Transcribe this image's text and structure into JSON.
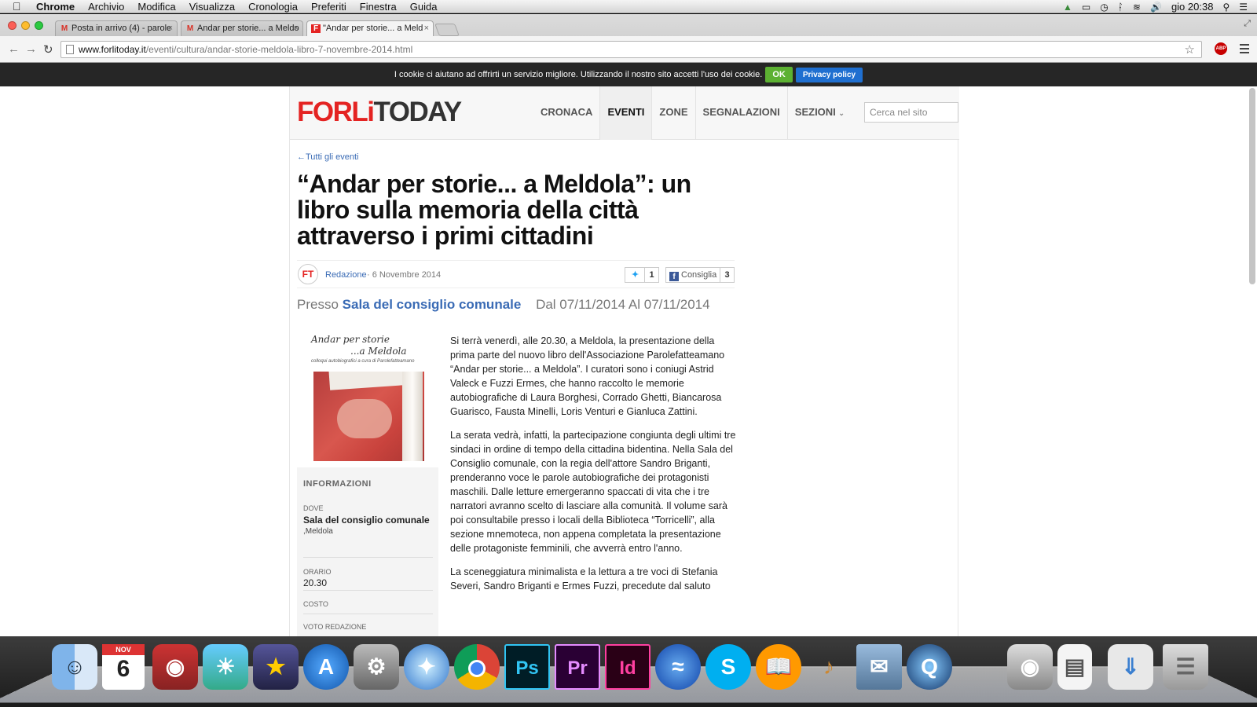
{
  "menubar": {
    "app": "Chrome",
    "items": [
      "Archivio",
      "Modifica",
      "Visualizza",
      "Cronologia",
      "Preferiti",
      "Finestra",
      "Guida"
    ],
    "clock": "gio 20:38"
  },
  "tabs": [
    {
      "label": "Posta in arrivo (4) - parole",
      "icon": "gmail-icon",
      "active": false
    },
    {
      "label": "Andar per storie... a Meldo",
      "icon": "gmail-icon",
      "active": false
    },
    {
      "label": "\"Andar per storie... a Meld",
      "icon": "forlitoday-icon",
      "active": true
    }
  ],
  "address": {
    "domain": "www.forlitoday.it",
    "path": "/eventi/cultura/andar-storie-meldola-libro-7-novembre-2014.html"
  },
  "cookie": {
    "text": "I cookie ci aiutano ad offrirti un servizio migliore. Utilizzando il nostro sito accetti l'uso dei cookie.",
    "ok": "OK",
    "privacy": "Privacy policy"
  },
  "site": {
    "logo_a": "FORLi",
    "logo_b": "TODAY",
    "nav": [
      "CRONACA",
      "EVENTI",
      "ZONE",
      "SEGNALAZIONI",
      "SEZIONI"
    ],
    "active_nav": "EVENTI",
    "search_placeholder": "Cerca nel sito"
  },
  "article": {
    "back": "←Tutti gli eventi",
    "title": "“Andar per storie... a Meldola”: un libro sulla memoria della città attraverso i primi cittadini",
    "avatar": "FT",
    "author": "Redazione",
    "date": "· 6 Novembre 2014",
    "tweet_count": "1",
    "fb_label": "Consiglia",
    "fb_count": "3",
    "presso": "Presso",
    "location": "Sala del consiglio comunale",
    "dates": "Dal 07/11/2014 Al 07/11/2014",
    "paragraphs": [
      "Si terrà venerdì, alle 20.30, a Meldola, la presentazione della prima parte del nuovo libro dell'Associazione Parolefatteamano “Andar per storie... a Meldola”. I curatori sono i coniugi Astrid Valeck e Fuzzi Ermes, che hanno raccolto le memorie autobiografiche di Laura Borghesi, Corrado Ghetti, Biancarosa Guarisco, Fausta Minelli, Loris Venturi e Gianluca Zattini.",
      "La serata vedrà, infatti, la partecipazione congiunta degli ultimi tre sindaci in ordine di tempo della cittadina bidentina. Nella Sala del Consiglio comunale, con la regia dell'attore Sandro Briganti, prenderanno voce le parole autobiografiche dei protagonisti maschili. Dalle letture emergeranno spaccati di vita che i tre narratori avranno scelto di lasciare alla comunità. Il volume sarà poi consultabile presso i locali della Biblioteca “Torricelli”, alla sezione mnemoteca, non appena completata la presentazione delle protagoniste femminili, che avverrà entro l'anno.",
      "La sceneggiatura minimalista e la lettura a tre voci di Stefania Severi, Sandro Briganti e Ermes Fuzzi, precedute dal saluto"
    ]
  },
  "sidebar": {
    "book_title_1": "Andar per storie",
    "book_title_2": "...a Meldola",
    "book_subtitle": "colloqui autobiografici a cura di Parolefatteamano",
    "info_heading": "INFORMAZIONI",
    "dove_label": "DOVE",
    "dove_value": "Sala del consiglio comunale",
    "dove_city": ",Meldola",
    "orario_label": "ORARIO",
    "orario_value": "20.30",
    "costo_label": "COSTO",
    "voto_label": "VOTO REDAZIONE"
  },
  "dock": [
    "finder-icon",
    "calendar-icon",
    "photo-booth-icon",
    "iphoto-icon",
    "imovie-icon",
    "app-store-icon",
    "system-preferences-icon",
    "safari-icon",
    "chrome-icon",
    "photoshop-icon",
    "premiere-icon",
    "indesign-icon",
    "dictionary-icon",
    "skype-icon",
    "ibooks-icon",
    "garageband-icon",
    "mail-icon",
    "quicktime-icon",
    "image-capture-icon",
    "preview-icon",
    "downloads-icon",
    "trash-icon"
  ],
  "dock_calendar": {
    "month": "NOV",
    "day": "6"
  },
  "dock_labels": {
    "ps": "Ps",
    "pr": "Pr",
    "id": "Id"
  },
  "colors": {
    "accent": "#e42322",
    "link": "#3a6bb5",
    "ok": "#5cb132",
    "privacy": "#1f6fd0"
  }
}
